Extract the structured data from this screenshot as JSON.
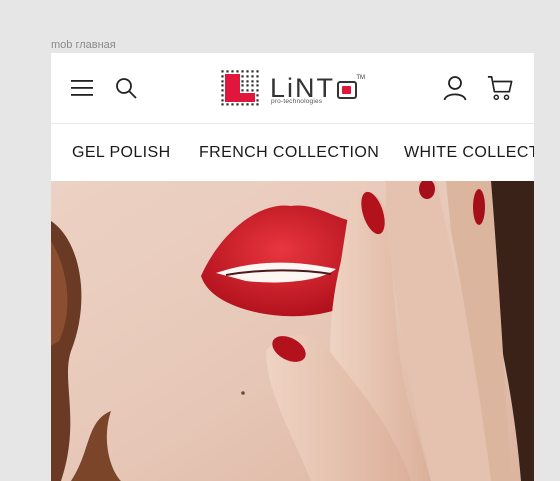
{
  "frame": {
    "label": "mob главная"
  },
  "header": {
    "menu_icon": "hamburger-icon",
    "search_icon": "search-icon",
    "account_icon": "user-icon",
    "cart_icon": "cart-icon",
    "logo": {
      "word": "LiNT",
      "subtitle": "pro-technologies",
      "tm": "TM"
    }
  },
  "nav": {
    "items": [
      {
        "label": "GEL POLISH"
      },
      {
        "label": "FRENCH COLLECTION"
      },
      {
        "label": "WHITE COLLECTION"
      }
    ]
  },
  "colors": {
    "accent": "#e0163c",
    "lip": "#cf1f2a",
    "text": "#1a1a1a",
    "background": "#e6e6e6"
  }
}
